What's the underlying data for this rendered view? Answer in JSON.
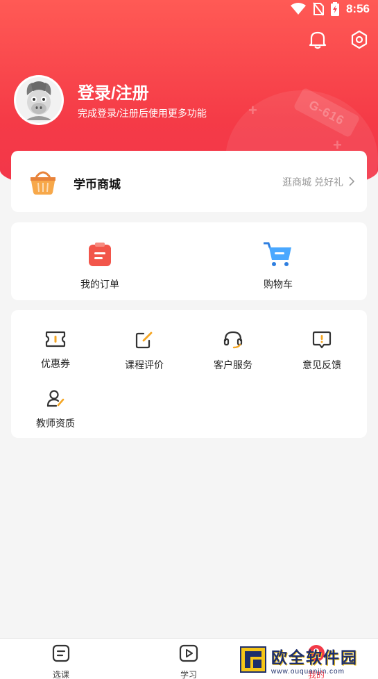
{
  "status_bar": {
    "time": "8:56"
  },
  "profile": {
    "title": "登录/注册",
    "subtitle": "完成登录/注册后使用更多功能",
    "decor_tag": "G-616"
  },
  "mall": {
    "title": "学币商城",
    "link_text": "逛商城 兑好礼"
  },
  "orders": {
    "items": [
      {
        "label": "我的订单",
        "icon": "clipboard-icon"
      },
      {
        "label": "购物车",
        "icon": "cart-icon"
      }
    ]
  },
  "tools": {
    "items": [
      {
        "label": "优惠券",
        "icon": "ticket-icon"
      },
      {
        "label": "课程评价",
        "icon": "edit-icon"
      },
      {
        "label": "客户服务",
        "icon": "headset-icon"
      },
      {
        "label": "意见反馈",
        "icon": "feedback-icon"
      },
      {
        "label": "教师资质",
        "icon": "teacher-icon"
      }
    ]
  },
  "tabbar": {
    "tabs": [
      {
        "label": "选课",
        "active": false
      },
      {
        "label": "学习",
        "active": false
      },
      {
        "label": "我的",
        "active": true
      }
    ]
  },
  "watermark": {
    "main": "欧全软件园",
    "url": "www.ouquanjin.com"
  },
  "colors": {
    "accent": "#f23a48",
    "orange": "#f5a623",
    "blue": "#3aa0ff"
  }
}
